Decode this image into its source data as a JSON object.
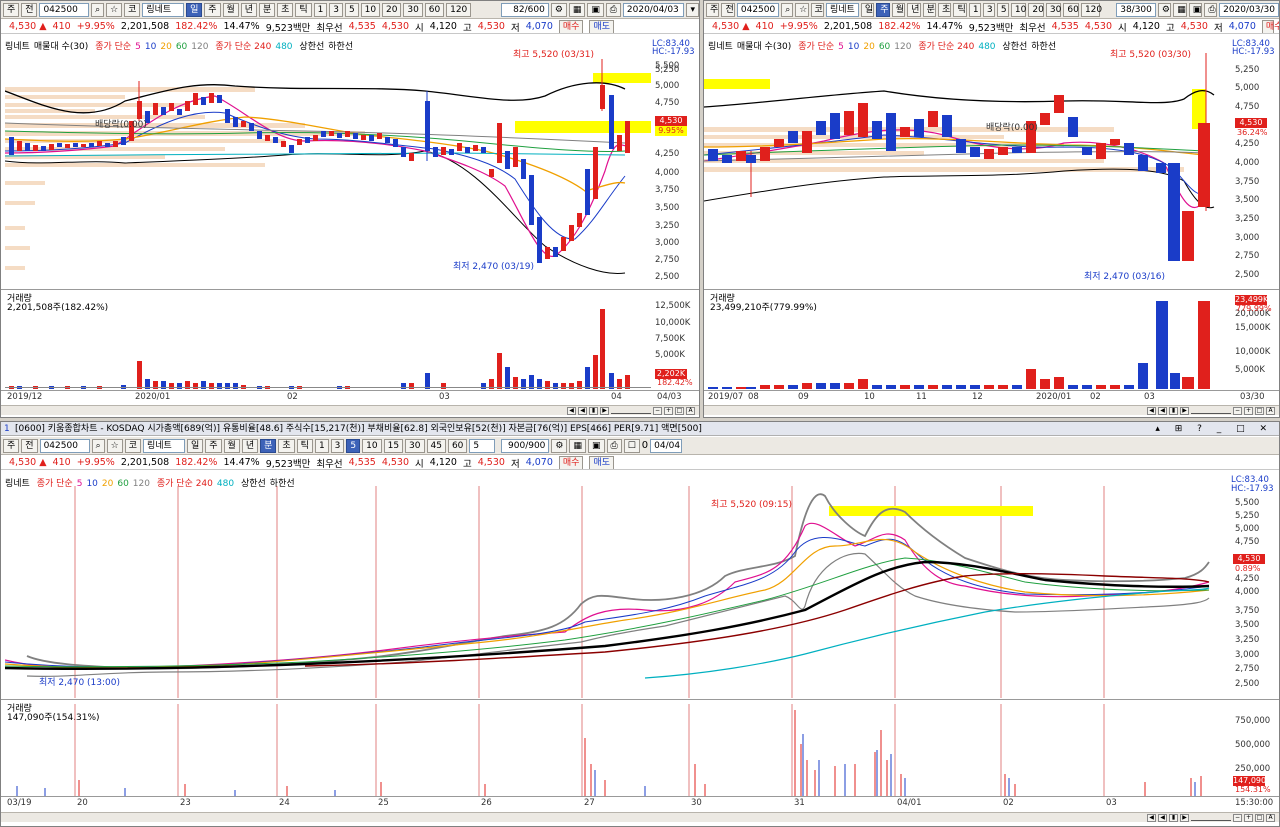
{
  "colors": {
    "up": "#e0201c",
    "down": "#1a3cc8",
    "highlight": "#ffff00",
    "bollinger": "#000000",
    "ma5": "#e01090",
    "ma10": "#1a3cc8",
    "ma20": "#f0a000",
    "ma60": "#20a040",
    "ma120": "#808080",
    "ma240": "#a03000",
    "ma480": "#00b0c0"
  },
  "toolbar": {
    "mode1": "주",
    "mode2": "전",
    "code": "042500",
    "market": "코",
    "stock_name": "링네트",
    "periods": [
      "일",
      "주",
      "월",
      "년",
      "분",
      "초",
      "틱"
    ],
    "intervals_top": [
      "1",
      "3",
      "5",
      "10",
      "20",
      "30",
      "60",
      "120"
    ],
    "intervals_bottom": [
      "1",
      "3",
      "5",
      "10",
      "15",
      "30",
      "45",
      "60",
      "5"
    ],
    "count_left": "82/600",
    "date_left": "2020/04/03",
    "count_right": "38/300",
    "date_right": "2020/03/30",
    "count_bottom": "900/900",
    "date_bottom": "04/04",
    "check_value": "0",
    "buy": "매수",
    "sell": "매도"
  },
  "quote": {
    "price": "4,530",
    "arrow": "▲",
    "change": "410",
    "pct": "+9.95%",
    "volume": "2,201,508",
    "vol_ratio": "182.42%",
    "turnover": "14.47%",
    "amount": "9,523백만",
    "best_ask_label": "최우선",
    "best_ask": "4,535",
    "best_bid": "4,530",
    "open_label": "시",
    "open": "4,120",
    "high_label": "고",
    "high": "4,530",
    "low_label": "저",
    "low": "4,070"
  },
  "bottom_title": "[0600] 키움종합차트 - KOSDAQ 시가총액[689(억)] 유통비율[48.6] 주식수[15,217(천)] 부채비율[62.8] 외국인보유[52(천)] 자본금[76(억)] EPS[466] PER[9.71] 액면[500]",
  "bottom_tab": "1",
  "legend": {
    "name": "링네트",
    "bb": "매물대 수(30)",
    "ma_label": "종가 단순",
    "ma_periods": [
      "5",
      "10",
      "20",
      "60",
      "120"
    ],
    "ma_long_label": "종가 단순 240",
    "ma_long2": "480",
    "upper": "상한선",
    "lower": "하한선"
  },
  "legend_bottom_name": "링네트",
  "left_chart": {
    "lc": "LC:83.40",
    "hc": "HC:-17.93",
    "high_note": "최고 5,520 (03/31)",
    "low_note": "최저 2,470 (03/19)",
    "dividend_note": "배당락(0.00)",
    "price_box": "4,530",
    "pct_box": "9.95%",
    "y_ticks": [
      "5,500",
      "5,250",
      "5,000",
      "4,750",
      "4,500",
      "4,250",
      "4,000",
      "3,750",
      "3,500",
      "3,250",
      "3,000",
      "2,750",
      "2,500",
      "2,250"
    ],
    "volume_title": "거래량",
    "volume_value": "2,201,508주(182.42%)",
    "vol_ticks": [
      "12,500K",
      "10,000K",
      "7,500K",
      "5,000K",
      "2,500K"
    ],
    "vol_box": "2,202K",
    "vol_box2": "182.42%",
    "x_ticks": [
      "2019/12",
      "2020/01",
      "02",
      "03",
      "04"
    ],
    "x_end": "04/03"
  },
  "right_chart": {
    "lc": "LC:83.40",
    "hc": "HC:-17.93",
    "high_note": "최고 5,520 (03/30)",
    "low_note": "최저 2,470 (03/16)",
    "dividend_note": "배당락(0.00)",
    "price_box": "4,530",
    "pct_box": "36.24%",
    "y_ticks": [
      "5,500",
      "5,250",
      "5,000",
      "4,750",
      "4,500",
      "4,250",
      "4,000",
      "3,750",
      "3,500",
      "3,250",
      "3,000",
      "2,750",
      "2,500"
    ],
    "volume_title": "거래량",
    "volume_value": "23,499,210주(779.99%)",
    "vol_ticks": [
      "20,000K",
      "15,000K",
      "10,000K",
      "5,000K"
    ],
    "vol_box": "23,499K",
    "vol_box2": "779.99%",
    "x_ticks": [
      "2019/07",
      "08",
      "09",
      "10",
      "11",
      "12",
      "2020/01",
      "02",
      "03"
    ],
    "x_end": "03/30"
  },
  "bottom_chart": {
    "lc": "LC:83.40",
    "hc": "HC:-17.93",
    "high_note": "최고 5,520 (09:15)",
    "low_note": "최저 2,470 (13:00)",
    "price_box": "4,530",
    "pct_box": "0.89%",
    "y_ticks": [
      "5,500",
      "5,250",
      "5,000",
      "4,750",
      "4,500",
      "4,250",
      "4,000",
      "3,750",
      "3,500",
      "3,250",
      "3,000",
      "2,750",
      "2,500"
    ],
    "volume_title": "거래량",
    "volume_value": "147,090주(154.31%)",
    "vol_ticks": [
      "750,000",
      "500,000",
      "250,000"
    ],
    "vol_box": "147,090",
    "vol_box2": "154.31%",
    "x_ticks": [
      "03/19",
      "20",
      "23",
      "24",
      "25",
      "26",
      "27",
      "30",
      "31",
      "04/01",
      "02",
      "03"
    ],
    "x_end": "15:30:00"
  }
}
